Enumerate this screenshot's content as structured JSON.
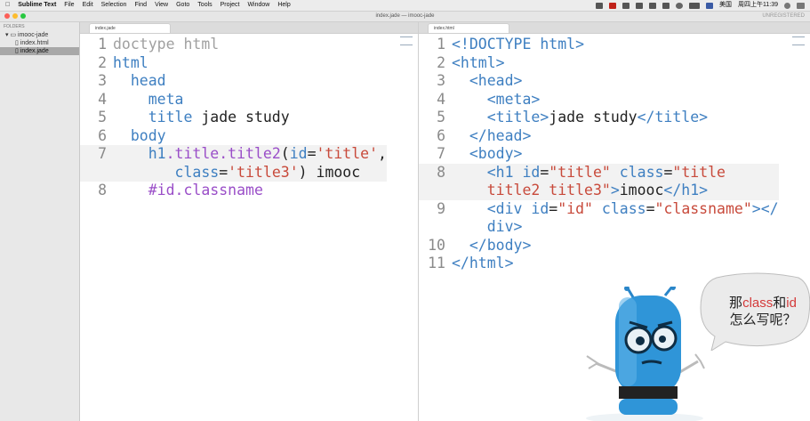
{
  "menubar": {
    "apple": "",
    "app": "Sublime Text",
    "items": [
      "File",
      "Edit",
      "Selection",
      "Find",
      "View",
      "Goto",
      "Tools",
      "Project",
      "Window",
      "Help"
    ],
    "lang": "美国",
    "clock": "周四上午11:39"
  },
  "window": {
    "title": "index.jade — imooc-jade",
    "unregistered": "UNREGISTERED"
  },
  "sidebar": {
    "header": "FOLDERS",
    "folder": "imooc-jade",
    "files": [
      "index.html",
      "index.jade"
    ],
    "selected": "index.jade"
  },
  "left_pane": {
    "tab": "index.jade"
  },
  "right_pane": {
    "tab": "index.html"
  },
  "bubble": {
    "line1_a": "那",
    "line1_b": "class",
    "line1_c": "和",
    "line1_d": "id",
    "line2": "怎么写呢？"
  },
  "colors": {
    "keyword": "#3e7fc1",
    "string": "#c84a3b",
    "selector": "#9a4ec8",
    "comment": "#a0a0a0",
    "accent": "#d43a3a"
  }
}
